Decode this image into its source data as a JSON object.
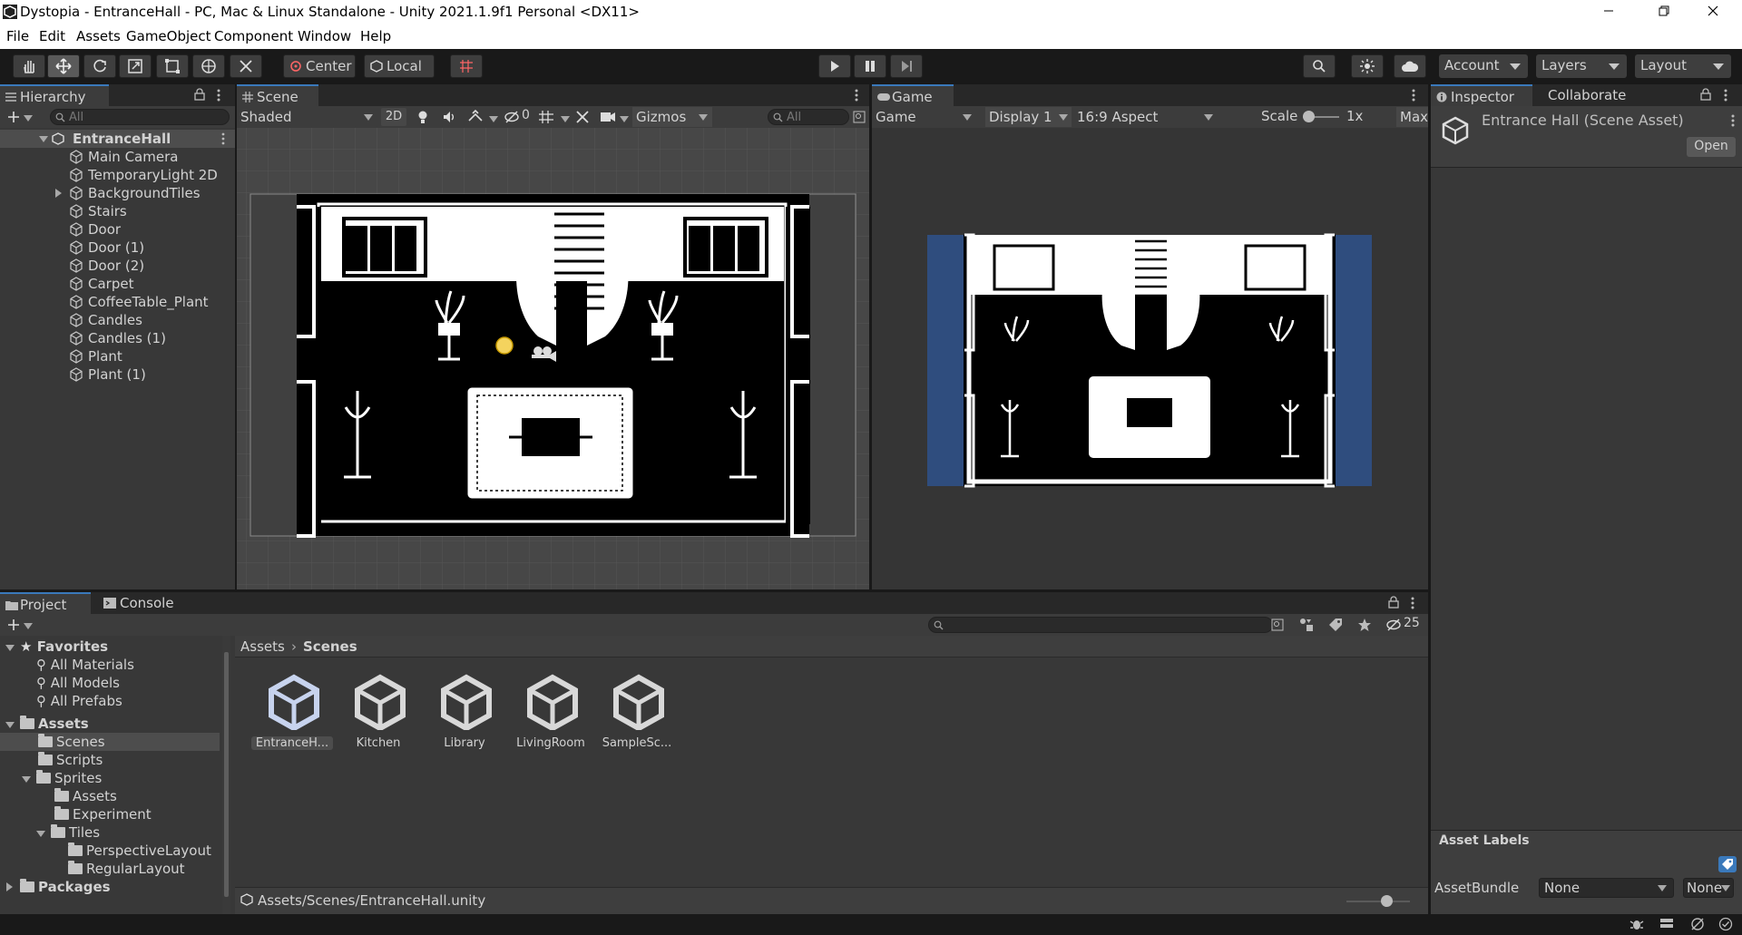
{
  "window": {
    "title": "Dystopia - EntranceHall - PC, Mac & Linux Standalone - Unity 2021.1.9f1 Personal <DX11>"
  },
  "menu": [
    "File",
    "Edit",
    "Assets",
    "GameObject",
    "Component",
    "Window",
    "Help"
  ],
  "toolbar": {
    "pivot_label": "Center",
    "space_label": "Local",
    "account_label": "Account",
    "layers_label": "Layers",
    "layout_label": "Layout"
  },
  "hierarchy": {
    "tab_label": "Hierarchy",
    "search_placeholder": "All",
    "scene_name": "EntranceHall",
    "items": [
      {
        "name": "Main Camera",
        "expandable": false
      },
      {
        "name": "TemporaryLight 2D",
        "expandable": false
      },
      {
        "name": "BackgroundTiles",
        "expandable": true
      },
      {
        "name": "Stairs",
        "expandable": false
      },
      {
        "name": "Door",
        "expandable": false
      },
      {
        "name": "Door (1)",
        "expandable": false
      },
      {
        "name": "Door (2)",
        "expandable": false
      },
      {
        "name": "Carpet",
        "expandable": false
      },
      {
        "name": "CoffeeTable_Plant",
        "expandable": false
      },
      {
        "name": "Candles",
        "expandable": false
      },
      {
        "name": "Candles (1)",
        "expandable": false
      },
      {
        "name": "Plant",
        "expandable": false
      },
      {
        "name": "Plant (1)",
        "expandable": false
      }
    ]
  },
  "scene": {
    "tab_label": "Scene",
    "shading": "Shaded",
    "mode_2d": "2D",
    "hidden_count": "0",
    "gizmos_label": "Gizmos",
    "search_placeholder": "All"
  },
  "game": {
    "tab_label": "Game",
    "view": "Game",
    "display": "Display 1",
    "aspect": "16:9 Aspect",
    "scale_label": "Scale",
    "scale_value": "1x",
    "maximize": "Max"
  },
  "inspector": {
    "tab_label": "Inspector",
    "collab_tab": "Collaborate",
    "asset_title": "Entrance Hall (Scene Asset)",
    "open_button": "Open",
    "asset_labels": "Asset Labels",
    "assetbundle_label": "AssetBundle",
    "assetbundle_value": "None",
    "variant_value": "None"
  },
  "project": {
    "tab_label": "Project",
    "console_tab": "Console",
    "hidden_count": "25",
    "breadcrumb": [
      "Assets",
      "Scenes"
    ],
    "favorites_label": "Favorites",
    "favorites": [
      "All Materials",
      "All Models",
      "All Prefabs"
    ],
    "tree": {
      "assets": "Assets",
      "scenes": "Scenes",
      "scripts": "Scripts",
      "sprites": "Sprites",
      "sprites_assets": "Assets",
      "experiment": "Experiment",
      "tiles": "Tiles",
      "perspective": "PerspectiveLayout",
      "regular": "RegularLayout",
      "packages": "Packages"
    },
    "assets": [
      "EntranceH...",
      "Kitchen",
      "Library",
      "LivingRoom",
      "SampleSc..."
    ],
    "selected_asset": "EntranceH...",
    "path": "Assets/Scenes/EntranceHall.unity"
  },
  "colors": {
    "accent": "#3a79bb",
    "panel": "#383838",
    "game_bg_letterbox": "#2f4d7e",
    "selection": "#4d4d4d"
  }
}
